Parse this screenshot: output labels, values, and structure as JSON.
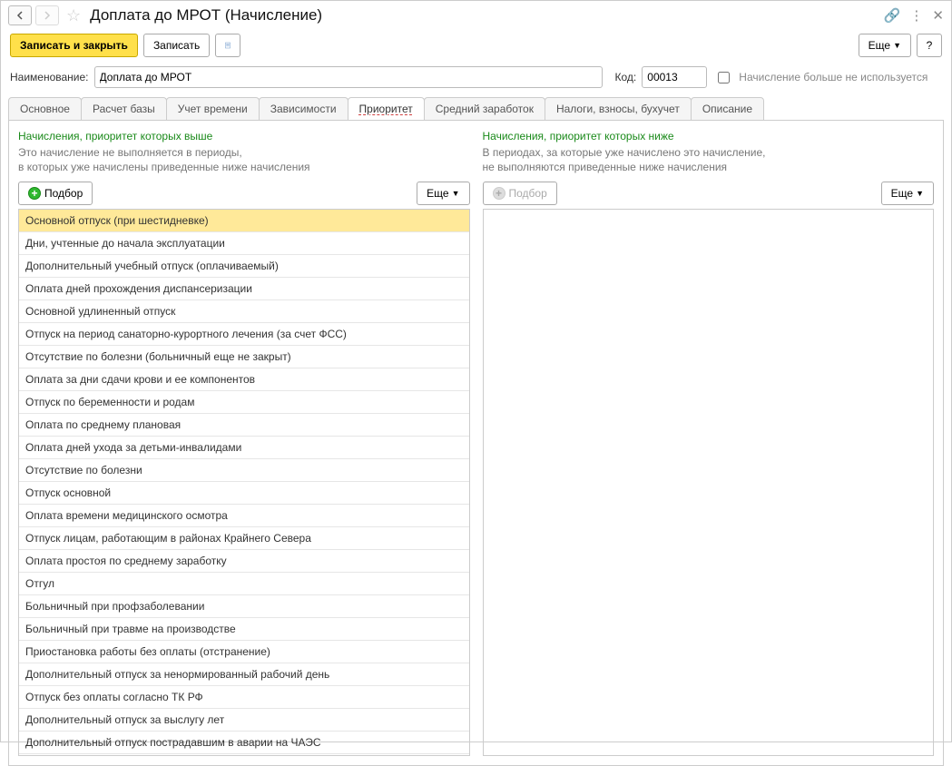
{
  "title": "Доплата до МРОТ (Начисление)",
  "toolbar": {
    "save_close": "Записать и закрыть",
    "save": "Записать",
    "more": "Еще",
    "help": "?"
  },
  "fields": {
    "name_label": "Наименование:",
    "name_value": "Доплата до МРОТ",
    "code_label": "Код:",
    "code_value": "00013",
    "no_longer_used_label": "Начисление больше не используется"
  },
  "tabs": [
    {
      "id": "main",
      "label": "Основное"
    },
    {
      "id": "base",
      "label": "Расчет базы"
    },
    {
      "id": "time",
      "label": "Учет времени"
    },
    {
      "id": "deps",
      "label": "Зависимости"
    },
    {
      "id": "priority",
      "label": "Приоритет",
      "active": true
    },
    {
      "id": "avg",
      "label": "Средний заработок"
    },
    {
      "id": "tax",
      "label": "Налоги, взносы, бухучет"
    },
    {
      "id": "desc",
      "label": "Описание"
    }
  ],
  "left_panel": {
    "title": "Начисления, приоритет которых выше",
    "desc_l1": "Это начисление не выполняется в периоды,",
    "desc_l2": "в которых уже начислены приведенные ниже начисления",
    "add_label": "Подбор",
    "more_label": "Еще",
    "items": [
      "Основной отпуск (при шестидневке)",
      "Дни, учтенные до начала эксплуатации",
      "Дополнительный учебный отпуск (оплачиваемый)",
      "Оплата дней прохождения диспансеризации",
      "Основной удлиненный отпуск",
      "Отпуск на период санаторно-курортного лечения (за счет ФСС)",
      "Отсутствие по болезни (больничный еще не закрыт)",
      "Оплата за дни сдачи крови и ее компонентов",
      "Отпуск по беременности и родам",
      "Оплата по среднему плановая",
      "Оплата дней ухода за детьми-инвалидами",
      "Отсутствие по болезни",
      "Отпуск основной",
      "Оплата времени медицинского осмотра",
      "Отпуск лицам, работающим в районах Крайнего Севера",
      "Оплата простоя по среднему заработку",
      "Отгул",
      "Больничный при профзаболевании",
      "Больничный при травме на производстве",
      "Приостановка работы без оплаты (отстранение)",
      "Дополнительный отпуск за ненормированный рабочий день",
      "Отпуск без оплаты согласно ТК РФ",
      "Дополнительный отпуск за выслугу лет",
      "Дополнительный отпуск пострадавшим в аварии на ЧАЭС"
    ]
  },
  "right_panel": {
    "title": "Начисления, приоритет которых ниже",
    "desc_l1": "В периодах, за которые уже начислено это начисление,",
    "desc_l2": "не выполняются приведенные ниже начисления",
    "add_label": "Подбор",
    "more_label": "Еще"
  }
}
